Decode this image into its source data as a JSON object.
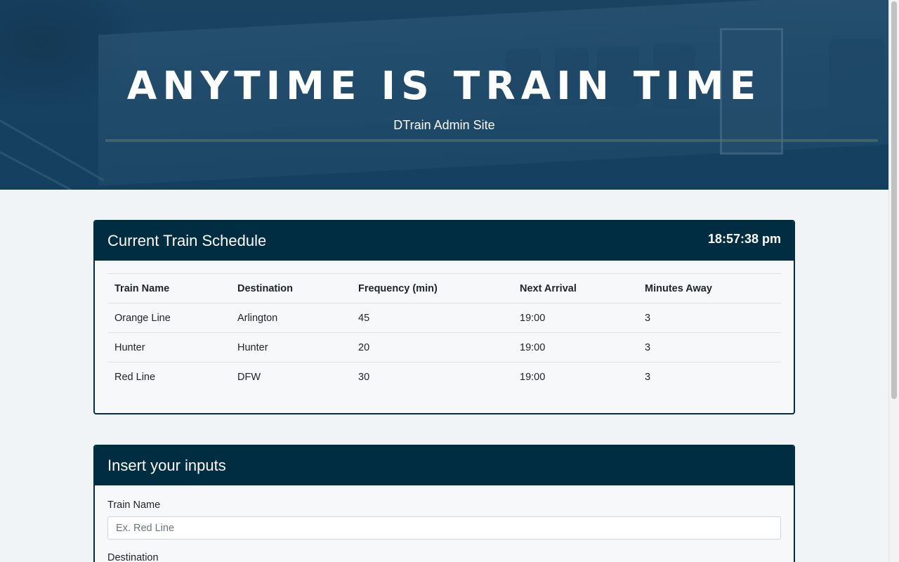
{
  "hero": {
    "title": "ANYTIME IS TRAIN TIME",
    "subtitle": "DTrain Admin Site"
  },
  "schedule": {
    "title": "Current Train Schedule",
    "clock": "18:57:38 pm",
    "columns": [
      "Train Name",
      "Destination",
      "Frequency (min)",
      "Next Arrival",
      "Minutes Away"
    ],
    "rows": [
      [
        "Orange Line",
        "Arlington",
        "45",
        "19:00",
        "3"
      ],
      [
        "Hunter",
        "Hunter",
        "20",
        "19:00",
        "3"
      ],
      [
        "Red Line",
        "DFW",
        "30",
        "19:00",
        "3"
      ]
    ]
  },
  "inputs": {
    "title": "Insert your inputs",
    "train_name_label": "Train Name",
    "train_name_placeholder": "Ex. Red Line",
    "destination_label": "Destination"
  },
  "colors": {
    "header_navy": "#012d42",
    "hero_blue": "#1d4a69",
    "page_bg": "#f1f4f6"
  }
}
